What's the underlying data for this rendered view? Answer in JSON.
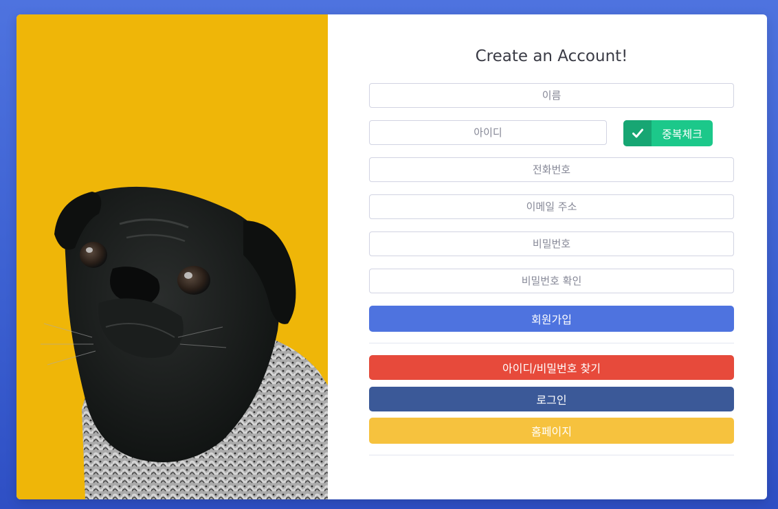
{
  "form": {
    "title": "Create an Account!",
    "name_placeholder": "이름",
    "id_placeholder": "아이디",
    "dup_check_label": "중복체크",
    "phone_placeholder": "전화번호",
    "email_placeholder": "이메일 주소",
    "password_placeholder": "비밀번호",
    "password_confirm_placeholder": "비밀번호 확인",
    "register_label": "회원가입"
  },
  "links": {
    "find_label": "아이디/비밀번호 찾기",
    "login_label": "로그인",
    "home_label": "홈페이지"
  },
  "icons": {
    "dup_check": "check-icon"
  },
  "colors": {
    "background": "#4e73df",
    "photo_bg": "#efb608",
    "primary": "#4e73df",
    "success": "#1cc88a",
    "danger": "#e74a3b",
    "login": "#3b5998",
    "warning": "#f6c23e"
  }
}
